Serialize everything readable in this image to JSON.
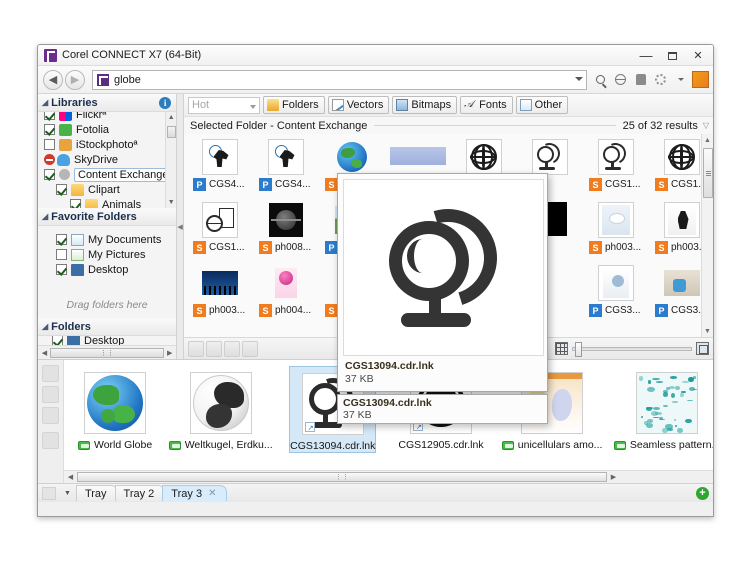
{
  "window": {
    "title": "Corel CONNECT X7 (64-Bit)",
    "minimize": "—",
    "maximize": "□",
    "close": "✕"
  },
  "address": {
    "back": "◀",
    "forward": "▶",
    "value": "globe",
    "tools": [
      "search-icon",
      "globe-icon",
      "upload-icon",
      "gear-icon",
      "corel-icon"
    ]
  },
  "sidebar": {
    "libraries": {
      "title": "Libraries",
      "info": "i",
      "items": [
        {
          "label": "Flickrª",
          "checked": true,
          "icon": "flickr-icon",
          "indent": 0
        },
        {
          "label": "Fotolia",
          "checked": true,
          "icon": "fotolia-icon",
          "indent": 0
        },
        {
          "label": "iStockphotoª",
          "checked": false,
          "icon": "istock-icon",
          "indent": 0
        },
        {
          "label": "SkyDrive",
          "checked": false,
          "icon": "skydrive-icon",
          "indent": 0
        },
        {
          "label": "Content Exchange",
          "checked": true,
          "icon": "content-exchange-icon",
          "indent": 0,
          "selected": true
        },
        {
          "label": "Clipart",
          "checked": true,
          "icon": "folder-icon",
          "indent": 1
        },
        {
          "label": "Animals",
          "checked": true,
          "icon": "folder-icon",
          "indent": 2
        }
      ]
    },
    "favorites": {
      "title": "Favorite Folders",
      "items": [
        {
          "label": "My Documents",
          "checked": true,
          "icon": "documents-icon"
        },
        {
          "label": "My Pictures",
          "checked": false,
          "icon": "pictures-icon"
        },
        {
          "label": "Desktop",
          "checked": true,
          "icon": "desktop-icon"
        }
      ],
      "drag_hint": "Drag folders here"
    },
    "folders": {
      "title": "Folders",
      "first_item": "Desktop"
    }
  },
  "filterbar": {
    "source_select": "Hot",
    "buttons": [
      {
        "label": "Folders",
        "icon": "folders-icon"
      },
      {
        "label": "Vectors",
        "icon": "vectors-icon"
      },
      {
        "label": "Bitmaps",
        "icon": "bitmaps-icon"
      },
      {
        "label": "Fonts",
        "icon": "fonts-icon"
      },
      {
        "label": "Other",
        "icon": "other-icon"
      }
    ]
  },
  "results": {
    "header": "Selected Folder - Content Exchange",
    "count": "25 of 32 results",
    "items": [
      {
        "label": "CGS4...",
        "badge": "P",
        "art": "ppt-network"
      },
      {
        "label": "CGS4...",
        "badge": "P",
        "art": "ppt-network2"
      },
      {
        "label": "",
        "badge": "S",
        "art": "earth-clipart"
      },
      {
        "label": "",
        "badge": "",
        "art": "blue-bar"
      },
      {
        "label": "",
        "badge": "",
        "art": "globe-wire-1"
      },
      {
        "label": "",
        "badge": "",
        "art": "globe-stand-1"
      },
      {
        "label": "CGS1...",
        "badge": "S",
        "art": "globe-stand-2"
      },
      {
        "label": "CGS1...",
        "badge": "S",
        "art": "globe-wire-2"
      },
      {
        "label": "CGS1...",
        "badge": "S",
        "art": "doc-globe"
      },
      {
        "label": "ph008...",
        "badge": "S",
        "art": "dark-globe"
      },
      {
        "label": "",
        "badge": "P",
        "art": "city-photo"
      },
      {
        "label": "",
        "badge": "",
        "art": "hidden"
      },
      {
        "label": "",
        "badge": "",
        "art": "hidden"
      },
      {
        "label": "3...",
        "badge": "",
        "art": "black-block"
      },
      {
        "label": "ph003...",
        "badge": "S",
        "art": "cloudy"
      },
      {
        "label": "ph003...",
        "badge": "S",
        "art": "mountain"
      },
      {
        "label": "ph003...",
        "badge": "S",
        "art": "blue-people"
      },
      {
        "label": "ph004...",
        "badge": "S",
        "art": "pink-globe"
      },
      {
        "label": "",
        "badge": "S",
        "art": "yellow"
      },
      {
        "label": "",
        "badge": "",
        "art": "hidden"
      },
      {
        "label": "",
        "badge": "",
        "art": "hidden"
      },
      {
        "label": "...",
        "badge": "",
        "art": "hidden"
      },
      {
        "label": "CGS3...",
        "badge": "P",
        "art": "light-globe"
      },
      {
        "label": "CGS3...",
        "badge": "P",
        "art": "hands-globe"
      },
      {
        "label": "",
        "badge": "",
        "art": "partial"
      }
    ]
  },
  "preview": {
    "filename": "CGS13094.cdr.lnk",
    "filesize": "37 KB",
    "art": "globe-stand-icon"
  },
  "tray_tooltip": {
    "filename": "CGS13094.cdr.lnk",
    "filesize": "37 KB"
  },
  "tray": {
    "items": [
      {
        "label": "World Globe",
        "badge": "content-exchange-badge",
        "art": "earth-blue",
        "selected": false
      },
      {
        "label": "Weltkugel, Erdku...",
        "badge": "content-exchange-badge",
        "art": "earth-bw",
        "selected": false
      },
      {
        "label": "CGS13094.cdr.lnk",
        "badge": "",
        "art": "globe-stand",
        "selected": true
      },
      {
        "label": "CGS12905.cdr.lnk",
        "badge": "",
        "art": "globe-wire",
        "selected": false
      },
      {
        "label": "unicellulars amo...",
        "badge": "content-exchange-badge",
        "art": "cells",
        "selected": false
      },
      {
        "label": "Seamless pattern...",
        "badge": "content-exchange-badge",
        "art": "pattern",
        "selected": false
      }
    ],
    "tabs": [
      {
        "label": "Tray",
        "active": false,
        "closable": false
      },
      {
        "label": "Tray 2",
        "active": false,
        "closable": false
      },
      {
        "label": "Tray 3",
        "active": true,
        "closable": true,
        "close": "✕"
      }
    ],
    "add_tab": "+"
  },
  "colors": {
    "accent": "#2b7ccc",
    "badge_vector": "#f07c1e",
    "badge_bitmap": "#2b7ccc",
    "selection": "#d5e8f7",
    "brand": "#6a2d8f"
  }
}
